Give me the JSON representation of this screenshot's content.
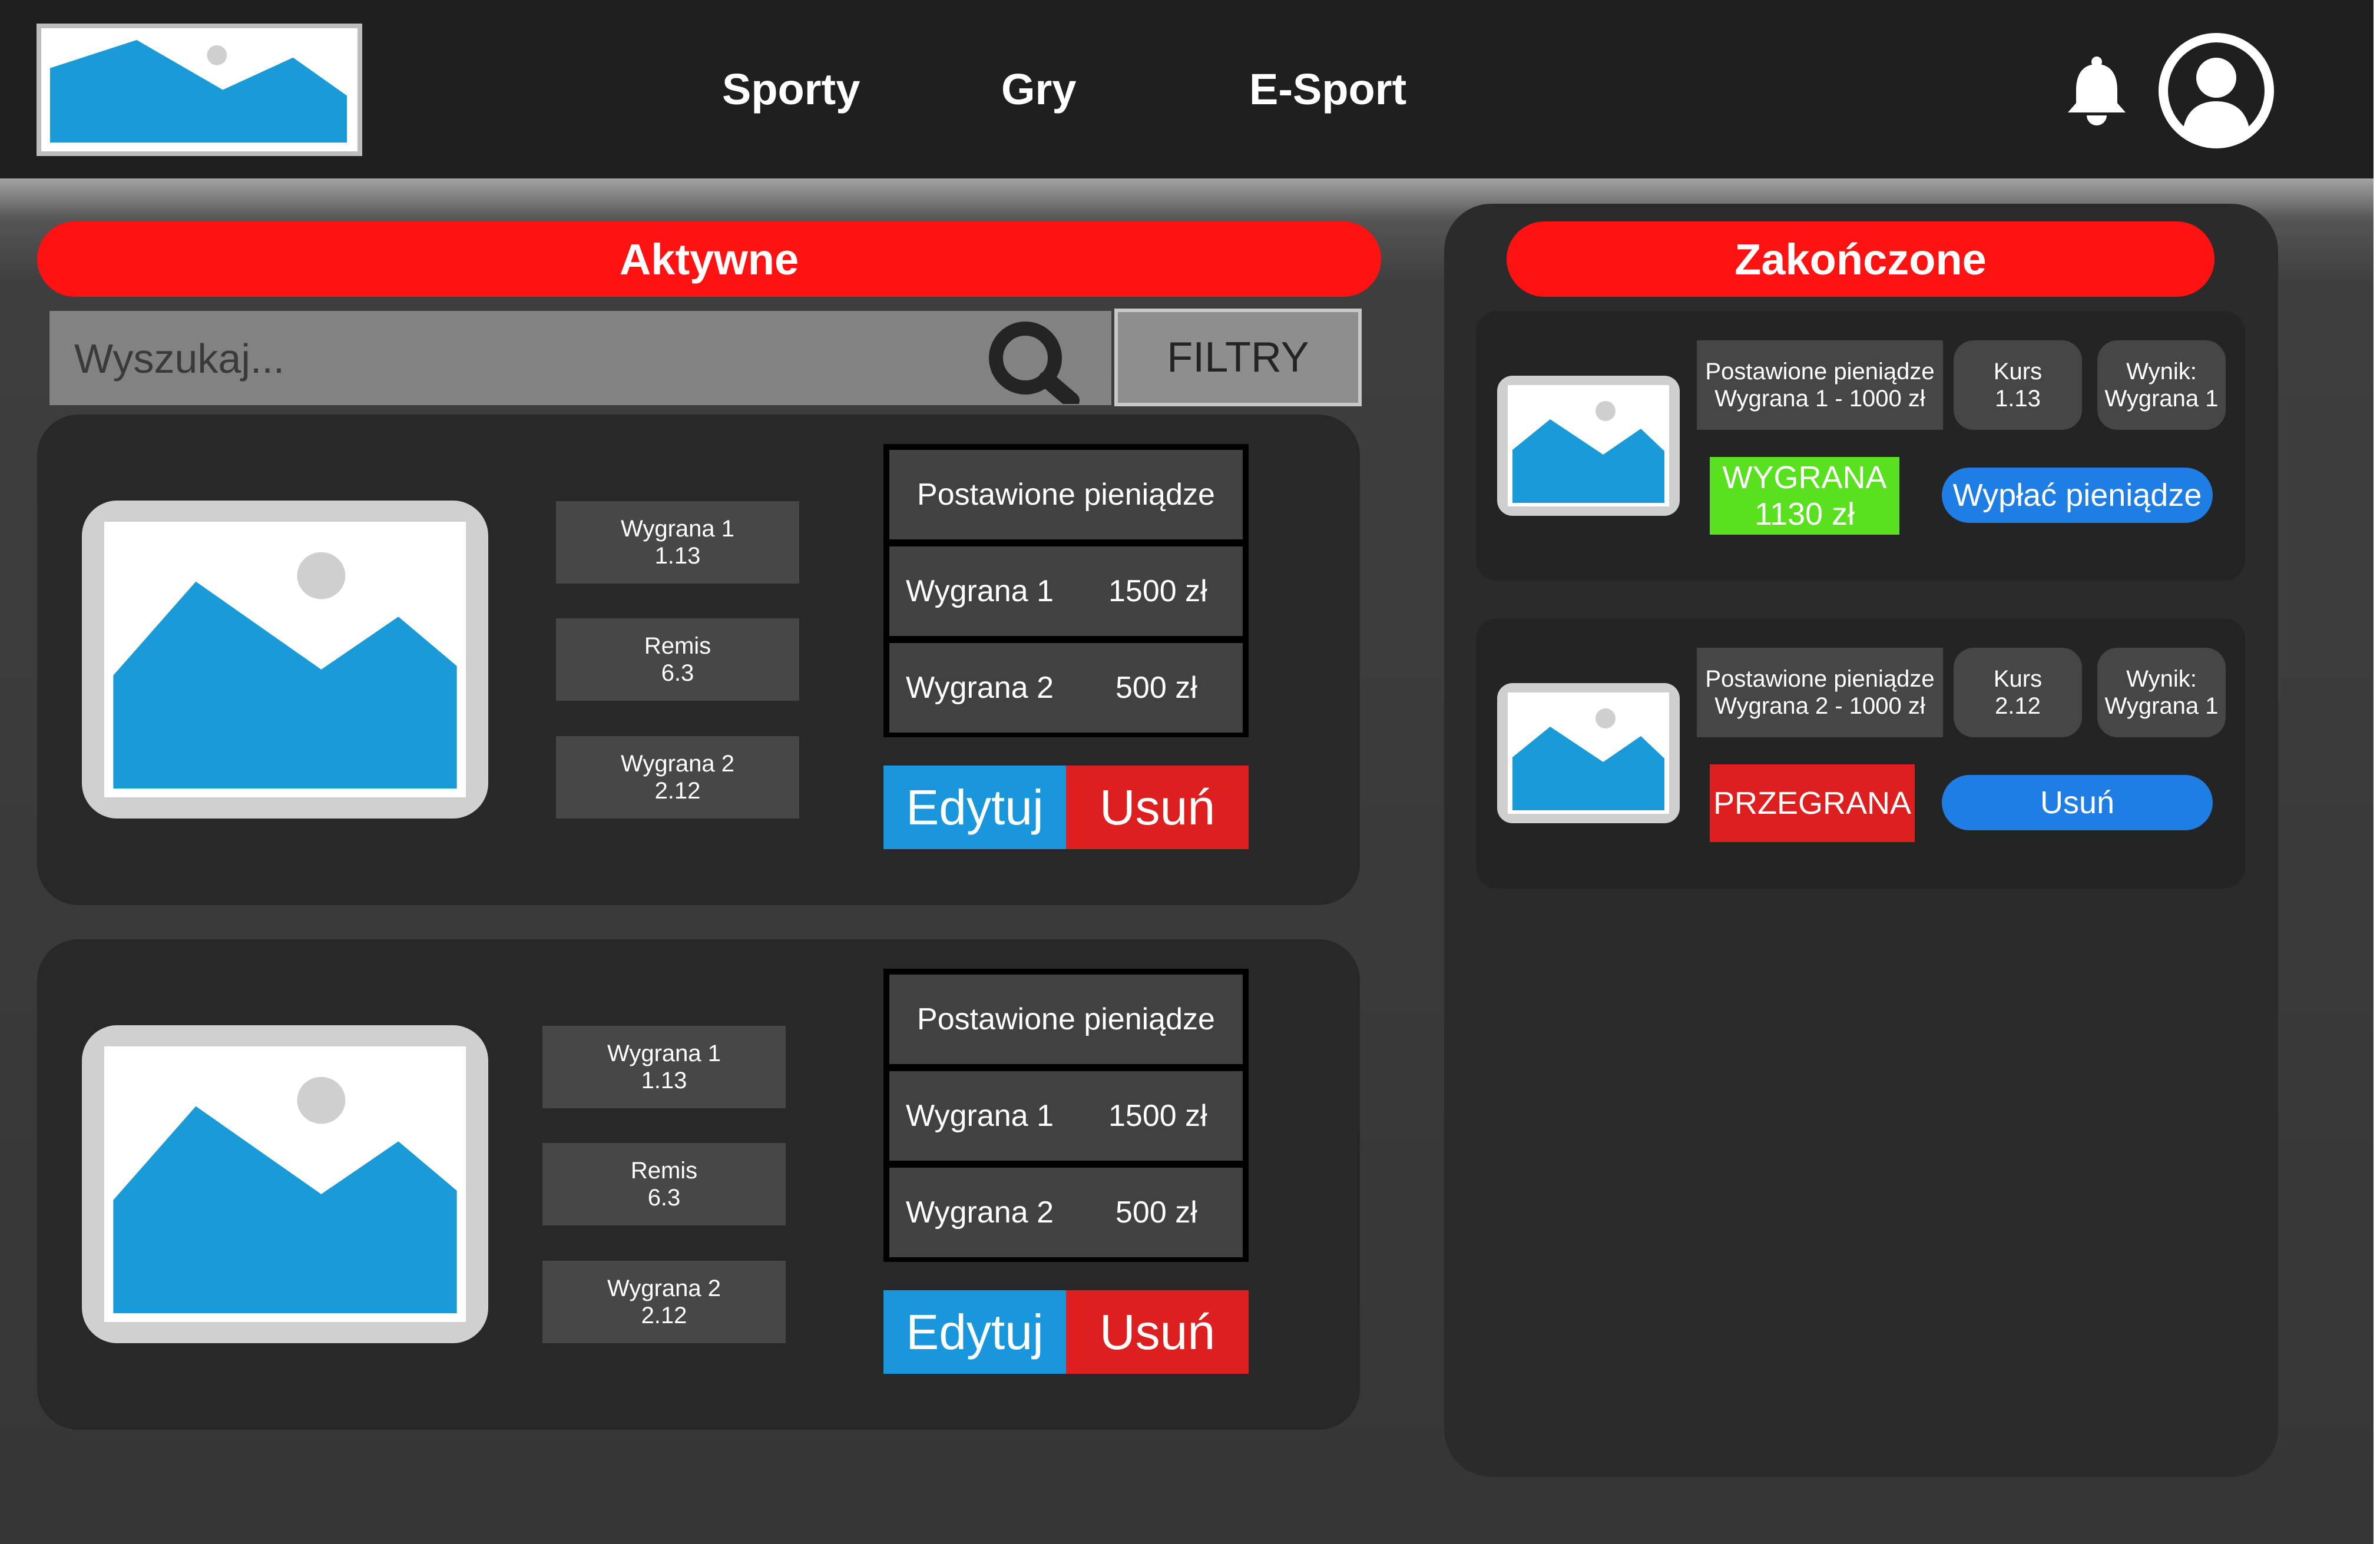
{
  "nav": {
    "items": [
      "Sporty",
      "Gry",
      "E-Sport"
    ],
    "icons": {
      "logo": "image-placeholder-icon",
      "notifications": "bell-icon",
      "account": "user-avatar-icon"
    }
  },
  "active": {
    "title": "Aktywne",
    "search_placeholder": "Wyszukaj...",
    "filter_label": "FILTRY",
    "bets": [
      {
        "odds": [
          {
            "label": "Wygrana 1",
            "value": "1.13"
          },
          {
            "label": "Remis",
            "value": "6.3"
          },
          {
            "label": "Wygrana 2",
            "value": "2.12"
          }
        ],
        "stake_header": "Postawione pieniądze",
        "stakes": [
          {
            "label": "Wygrana 1",
            "amount": "1500 zł"
          },
          {
            "label": "Wygrana 2",
            "amount": "500 zł"
          }
        ],
        "edit_label": "Edytuj",
        "delete_label": "Usuń"
      },
      {
        "odds": [
          {
            "label": "Wygrana 1",
            "value": "1.13"
          },
          {
            "label": "Remis",
            "value": "6.3"
          },
          {
            "label": "Wygrana 2",
            "value": "2.12"
          }
        ],
        "stake_header": "Postawione pieniądze",
        "stakes": [
          {
            "label": "Wygrana 1",
            "amount": "1500 zł"
          },
          {
            "label": "Wygrana 2",
            "amount": "500 zł"
          }
        ],
        "edit_label": "Edytuj",
        "delete_label": "Usuń"
      }
    ]
  },
  "finished": {
    "title": "Zakończone",
    "bets": [
      {
        "stake_label": "Postawione pieniądze",
        "stake_value": "Wygrana 1 - 1000 zł",
        "kurs_label": "Kurs",
        "kurs_value": "1.13",
        "result_label": "Wynik:",
        "result_value": "Wygrana 1",
        "status_line1": "WYGRANA",
        "status_line2": "1130 zł",
        "action_label": "Wypłać pieniądze"
      },
      {
        "stake_label": "Postawione pieniądze",
        "stake_value": "Wygrana 2 - 1000 zł",
        "kurs_label": "Kurs",
        "kurs_value": "2.12",
        "result_label": "Wynik:",
        "result_value": "Wygrana 1",
        "status_line1": "PRZEGRANA",
        "action_label": "Usuń"
      }
    ]
  },
  "colors": {
    "topbar": "#1f1f1f",
    "accent_red": "#ff1212",
    "win_green": "#59e01f",
    "edit_blue": "#1a96dc",
    "action_blue": "#1f7ee3",
    "delete_red": "#dd1f1f",
    "image_blue": "#1a9bd7"
  }
}
